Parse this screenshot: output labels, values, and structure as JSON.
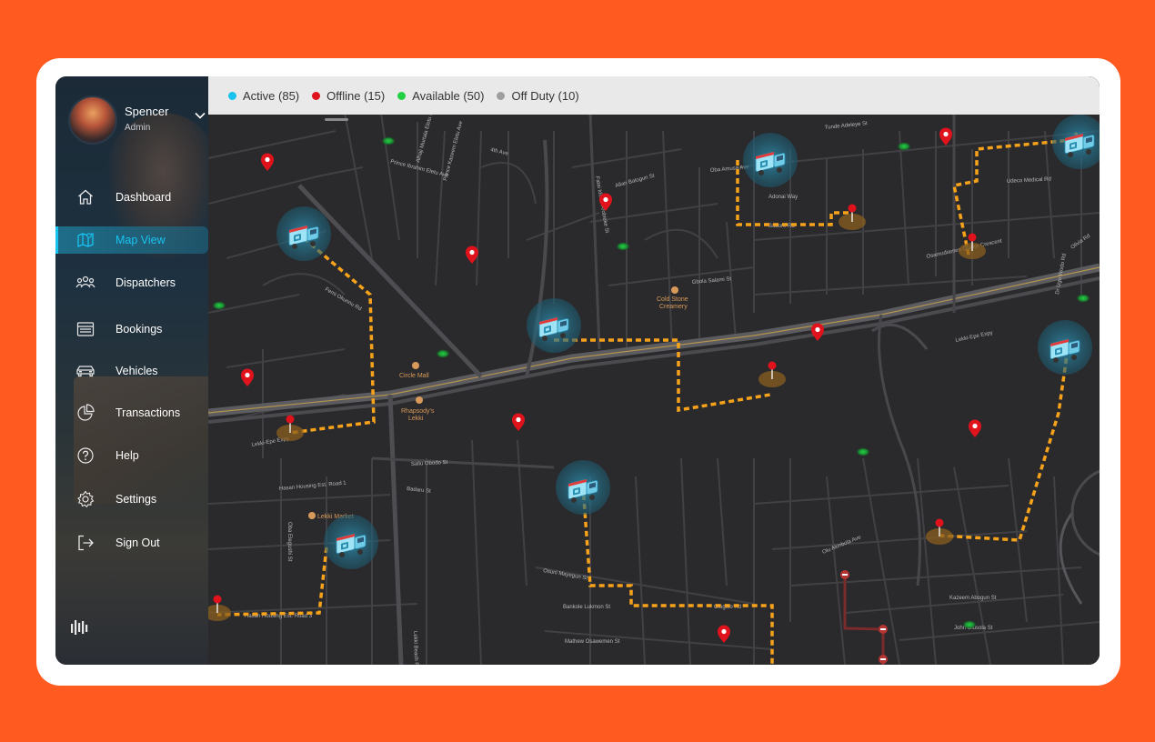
{
  "profile": {
    "name": "Spencer",
    "role": "Admin"
  },
  "nav": [
    {
      "label": "Dashboard",
      "icon": "home-icon"
    },
    {
      "label": "Map View",
      "icon": "map-icon",
      "active": true
    },
    {
      "label": "Dispatchers",
      "icon": "users-icon"
    },
    {
      "label": "Bookings",
      "icon": "bookings-icon"
    },
    {
      "label": "Vehicles",
      "icon": "car-icon"
    },
    {
      "label": "Transactions",
      "icon": "pie-chart-icon"
    },
    {
      "label": "Help",
      "icon": "help-icon"
    },
    {
      "label": "Settings",
      "icon": "gear-icon"
    },
    {
      "label": "Sign Out",
      "icon": "sign-out-icon"
    }
  ],
  "legend": [
    {
      "label": "Active (85)",
      "color": "#19c3f0"
    },
    {
      "label": "Offline (15)",
      "color": "#e0121b"
    },
    {
      "label": "Available (50)",
      "color": "#22d044"
    },
    {
      "label": "Off Duty (10)",
      "color": "#9e9e9e"
    }
  ],
  "map": {
    "streets": [
      "4th Ave",
      "Prince Ibrahim Eletu Ave",
      "Alhaji Murtala Eletu St",
      "Prince Kazeem Eletu Ave",
      "Allan Balogun St",
      "Oba Amusa Ave",
      "Adonai Way",
      "Badore Rd",
      "Udeco Medical Rd",
      "Tunde Adeleye St",
      "Osamudiamen Otabor Crescent",
      "Femi Okunnu Rd",
      "Gbola Salami St",
      "Lekki-Epe Expy",
      "Lekki-Epe Expy",
      "Saliu Obodo St",
      "Badaru St",
      "Hasan Housing Est. Road 1",
      "Hasan Housing Est. Road 3",
      "Oba Elegushi St",
      "Osuni Mayegun St",
      "Bankole Lukmon St",
      "Mathew Osawemen St",
      "Olu Akinbola Ave",
      "Kazeem Abogun St",
      "John Olusola St",
      "Lekki Beach Rd",
      "Ologolo Rd",
      "Fatai Idowu Arobieke St",
      "Olivia Rd",
      "Dr Ugo Wodo Rd"
    ],
    "pois": [
      "Cold Stone Creamery",
      "Circle Mall",
      "Rhapsody's Lekki",
      "Lekki Market"
    ]
  },
  "colors": {
    "accent": "#19c3f0",
    "route": "#f7a21b",
    "offline": "#e0121b",
    "available": "#22d044",
    "background": "#ff5a1f"
  }
}
